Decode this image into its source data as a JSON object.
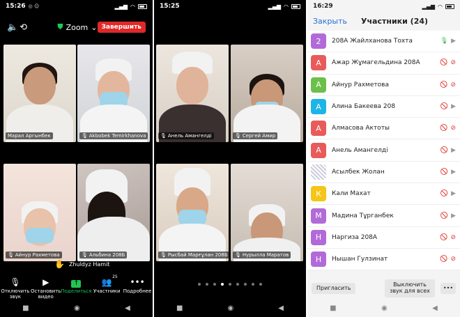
{
  "panel1": {
    "status": {
      "time": "15:26",
      "extra": "◎ ☺"
    },
    "zoom_title": "Zoom",
    "end_label": "Завершить",
    "tiles": [
      {
        "name": "Марал Аргынбек",
        "muted": false
      },
      {
        "name": "Akbobek Temirkhanova",
        "muted": true
      },
      {
        "name": "Айнур Рахметова",
        "muted": true
      },
      {
        "name": "Альбина 208Б",
        "muted": true
      }
    ],
    "raised_hand": "Zhuldyz Hamit",
    "toolbar": {
      "audio": "Отключить звук",
      "video": "Остановить видео",
      "share": "Поделиться",
      "participants": "Участники",
      "participants_count": "25",
      "more": "Подробнее"
    }
  },
  "panel2": {
    "status": {
      "time": "15:25"
    },
    "tiles": [
      {
        "name": "Анель Амангелді"
      },
      {
        "name": "Сергей Амир"
      },
      {
        "name": "Рысбай Марғұлан 208Б"
      },
      {
        "name": "Нурылла Маратов"
      }
    ]
  },
  "panel3": {
    "status": {
      "time": "16:29"
    },
    "close_label": "Закрыть",
    "title": "Участники (24)",
    "participants": [
      {
        "initial": "2",
        "name": "208А Жайлханова Тохта",
        "color": "#b26ad8",
        "mic": "on",
        "cam": "on"
      },
      {
        "initial": "А",
        "name": "Ажар Жұмагельдина 208А",
        "color": "#e95a5a",
        "mic": "off",
        "cam": "off"
      },
      {
        "initial": "А",
        "name": "Айнур Рахметова",
        "color": "#6cc04a",
        "mic": "off",
        "cam": "off"
      },
      {
        "initial": "А",
        "name": "Алина Бакеева 208",
        "color": "#1db5e6",
        "mic": "off",
        "cam": "on"
      },
      {
        "initial": "А",
        "name": "Алмасова Актоты",
        "color": "#e95a5a",
        "mic": "off",
        "cam": "off"
      },
      {
        "initial": "А",
        "name": "Анель Амангелді",
        "color": "#e95a5a",
        "mic": "off",
        "cam": "on"
      },
      {
        "initial": "",
        "name": "Асылбек Жолан",
        "color": "#ffffff",
        "mic": "off",
        "cam": "on"
      },
      {
        "initial": "К",
        "name": "Кали Махат",
        "color": "#f5c518",
        "mic": "off",
        "cam": "on"
      },
      {
        "initial": "М",
        "name": "Мадина Тұрганбек",
        "color": "#b26ad8",
        "mic": "off",
        "cam": "on"
      },
      {
        "initial": "Н",
        "name": "Наргиза 208А",
        "color": "#b26ad8",
        "mic": "off",
        "cam": "off"
      },
      {
        "initial": "Н",
        "name": "Нышан Гулзинат",
        "color": "#b26ad8",
        "mic": "off",
        "cam": "off"
      }
    ],
    "invite_label": "Пригласить",
    "mute_all_label": "Выключить звук для всех",
    "more_label": "•••"
  }
}
